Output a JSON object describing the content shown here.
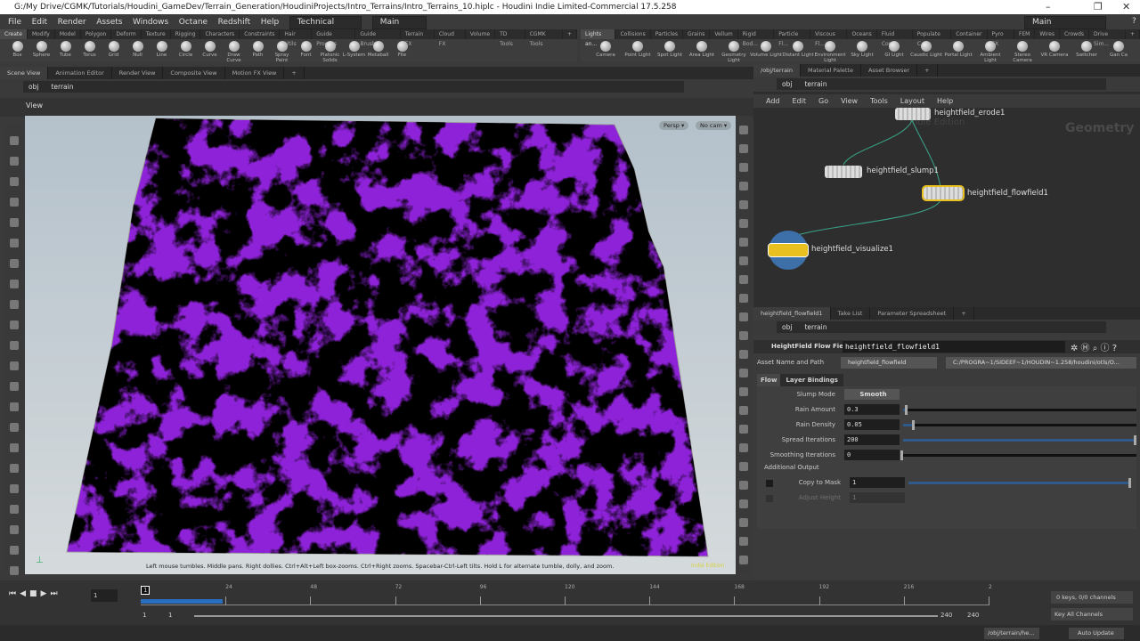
{
  "window": {
    "title": "G:/My Drive/CGMK/Tutorials/Houdini_GameDev/Terrain_Generation/HoudiniProjects/Intro_Terrains/Intro_Terrains_10.hiplc - Houdini Indie Limited-Commercial 17.5.258",
    "minimize": "–",
    "maximize": "❐",
    "close": "✕"
  },
  "menu": {
    "items": [
      "File",
      "Edit",
      "Render",
      "Assets",
      "Windows",
      "Octane",
      "Redshift",
      "Help"
    ],
    "desktop": "Technical",
    "desktop2": "Main",
    "desktop_right": "Main",
    "help": "?"
  },
  "shelf_left": {
    "tabs": [
      "Create",
      "Modify",
      "Model",
      "Polygon",
      "Deform",
      "Texture",
      "Rigging",
      "Characters",
      "Constraints",
      "Hair Utils",
      "Guide Process",
      "Guide Brushes",
      "Terrain FX",
      "Cloud FX",
      "Volume",
      "TD Tools",
      "CGMK Tools",
      "+"
    ],
    "tools": [
      "Box",
      "Sphere",
      "Tube",
      "Torus",
      "Grid",
      "Null",
      "Line",
      "Circle",
      "Curve",
      "Draw Curve",
      "Path",
      "Spray Paint",
      "Font",
      "Platonic Solids",
      "L-System",
      "Metaball",
      "File"
    ]
  },
  "shelf_right": {
    "tabs": [
      "Lights an...",
      "Collisions",
      "Particles",
      "Grains",
      "Vellum",
      "Rigid Bod...",
      "Particle Fl...",
      "Viscous Fl...",
      "Oceans",
      "Fluid Con...",
      "Populate C...",
      "Container",
      "Pyro FX",
      "FEM",
      "Wires",
      "Crowds",
      "Drive Sim...",
      "+"
    ],
    "tools": [
      "Camera",
      "Point Light",
      "Spot Light",
      "Area Light",
      "Geometry Light",
      "Volume Light",
      "Distant Light",
      "Environment Light",
      "Sky Light",
      "GI Light",
      "Caustic Light",
      "Portal Light",
      "Ambient Light",
      "Stereo Camera",
      "VR Camera",
      "Switcher",
      "Gan Ca"
    ]
  },
  "scene": {
    "tabs": [
      "Scene View",
      "Animation Editor",
      "Render View",
      "Composite View",
      "Motion FX View",
      "+"
    ],
    "path": [
      "obj",
      "terrain"
    ],
    "view_label": "View",
    "persp": "Persp ▾",
    "cam": "No cam ▾",
    "hint": "Left mouse tumbles. Middle pans. Right dollies. Ctrl+Alt+Left box-zooms. Ctrl+Right zooms. Spacebar-Ctrl-Left tilts. Hold L for alternate tumble, dolly, and zoom.",
    "watermark": "Indie Edition",
    "terrain_color": "#8e22d8"
  },
  "network": {
    "tabs": [
      "/obj/terrain",
      "Material Palette",
      "Asset Browser",
      "+"
    ],
    "path": [
      "obj",
      "terrain"
    ],
    "menu": [
      "Add",
      "Edit",
      "Go",
      "View",
      "Tools",
      "Layout",
      "Help"
    ],
    "context": "Geometry",
    "watermark": "Indie Edition",
    "nodes": [
      "heightfield_erode1",
      "heightfield_slump1",
      "heightfield_flowfield1",
      "heightfield_visualize1"
    ]
  },
  "params": {
    "tabs": [
      "heightfield_flowfield1",
      "Take List",
      "Parameter Spreadsheet",
      "+"
    ],
    "path": [
      "obj",
      "terrain"
    ],
    "node_type": "HeightField Flow Field",
    "node_name": "heightfield_flowfield1",
    "asset_label": "Asset Name and Path",
    "asset_name": "heightfield_flowfield",
    "asset_path": "C:/PROGRA~1/SIDEEF~1/HOUDIN~1.258/houdini/otls/O...",
    "subtabs": [
      "Flow",
      "Layer Bindings"
    ],
    "slump_mode": {
      "label": "Slump Mode",
      "value": "Smooth"
    },
    "fields": [
      {
        "label": "Rain Amount",
        "value": "0.3",
        "fill": 0.02
      },
      {
        "label": "Rain Density",
        "value": "0.05",
        "fill": 0.05
      },
      {
        "label": "Spread Iterations",
        "value": "200",
        "fill": 1.0
      },
      {
        "label": "Smoothing Iterations",
        "value": "0",
        "fill": 0
      }
    ],
    "additional_output": "Additional Output",
    "copy_to_mask": {
      "label": "Copy to Mask",
      "value": "1",
      "fill": 1.0
    },
    "adjust_height": {
      "label": "Adjust Height",
      "value": "1"
    }
  },
  "timeline": {
    "frame": "1",
    "marker": "1",
    "ticks": [
      "24",
      "48",
      "72",
      "96",
      "120",
      "144",
      "168",
      "192",
      "216",
      "2"
    ],
    "range_start": "1",
    "range_start2": "1",
    "range_end": "240",
    "range_end2": "240",
    "keys": "0 keys, 0/0 channels",
    "key_all": "Key All Channels"
  },
  "status": {
    "path": "/obj/terrain/he...",
    "update": "Auto Update"
  }
}
